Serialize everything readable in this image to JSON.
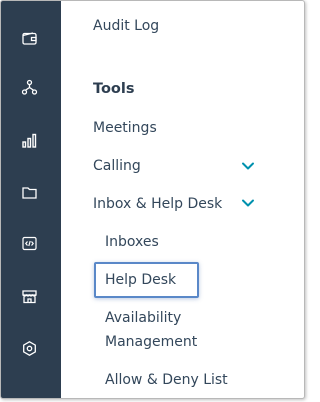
{
  "colors": {
    "rail_background": "#2d3e50",
    "rail_icon": "#ffffff",
    "menu_text": "#33475b",
    "chevron": "#0091ae",
    "highlight_border": "#5a88c8"
  },
  "rail": {
    "icons": [
      "wallet-icon",
      "hierarchy-icon",
      "reports-icon",
      "folder-icon",
      "code-icon",
      "storefront-icon",
      "settings-hex-icon"
    ]
  },
  "menu": {
    "audit_log": "Audit Log",
    "tools_heading": "Tools",
    "meetings": "Meetings",
    "calling": "Calling",
    "inbox_help_desk": "Inbox & Help Desk",
    "inboxes": "Inboxes",
    "help_desk": "Help Desk",
    "availability_line1": "Availability",
    "availability_line2": "Management",
    "allow_deny": "Allow & Deny List"
  }
}
